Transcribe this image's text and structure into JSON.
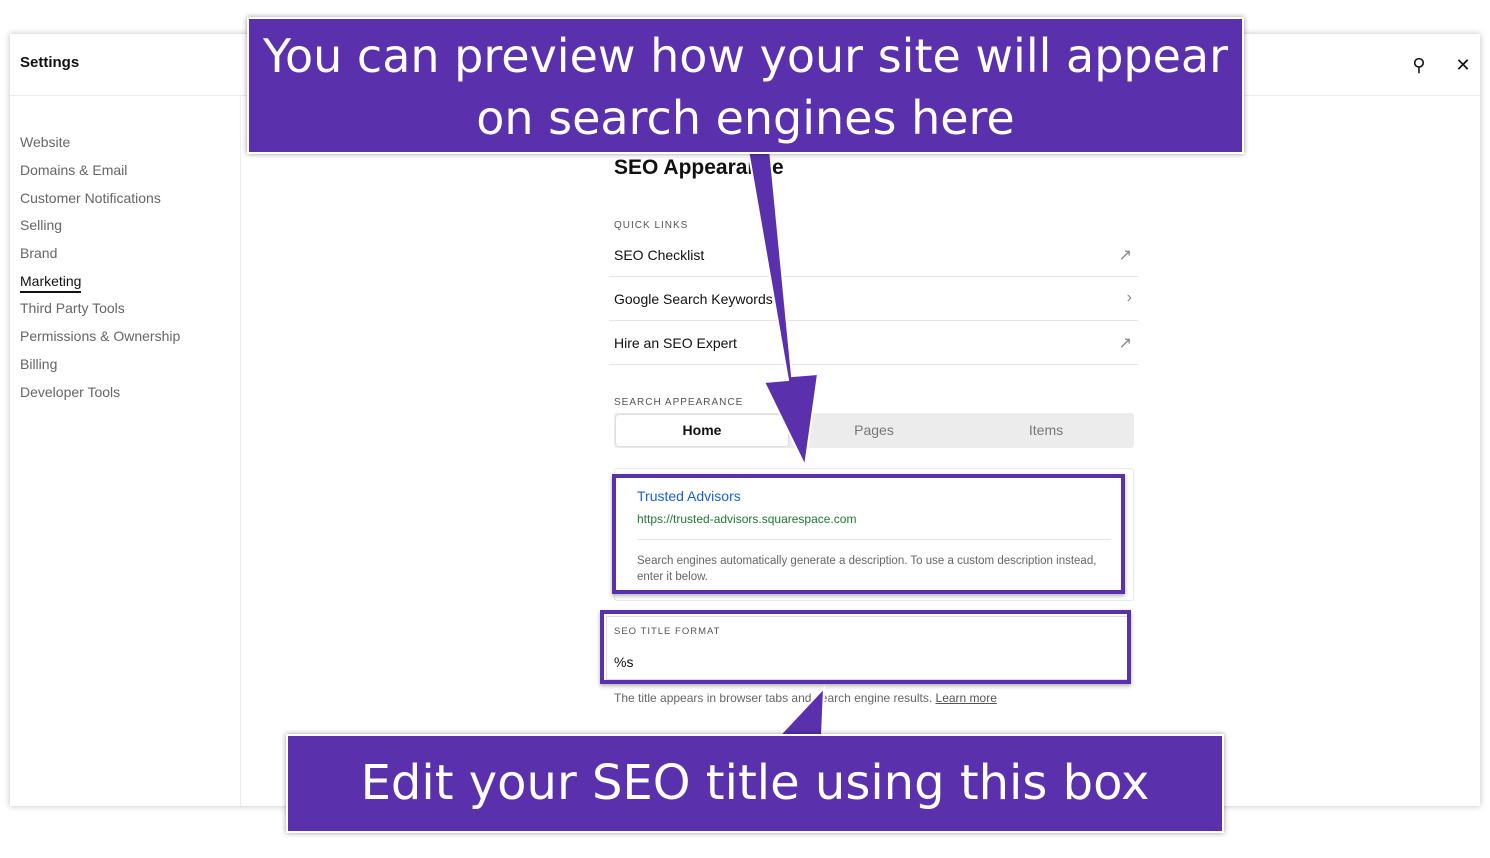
{
  "header": {
    "title": "Settings",
    "search_icon": "search-icon",
    "close_icon": "close-icon"
  },
  "sidebar": {
    "items": [
      {
        "label": "Website"
      },
      {
        "label": "Domains & Email"
      },
      {
        "label": "Customer Notifications"
      },
      {
        "label": "Selling"
      },
      {
        "label": "Brand"
      },
      {
        "label": "Marketing",
        "active": true
      },
      {
        "label": "Third Party Tools"
      },
      {
        "label": "Permissions & Ownership"
      },
      {
        "label": "Billing"
      },
      {
        "label": "Developer Tools"
      }
    ]
  },
  "main": {
    "title": "SEO Appearance",
    "quick_links_label": "QUICK LINKS",
    "quick_links": [
      {
        "label": "SEO Checklist",
        "icon": "external-link-icon"
      },
      {
        "label": "Google Search Keywords",
        "icon": "chevron-right-icon"
      },
      {
        "label": "Hire an SEO Expert",
        "icon": "external-link-icon"
      }
    ],
    "search_appearance_label": "SEARCH APPEARANCE",
    "tabs": [
      {
        "label": "Home",
        "active": true
      },
      {
        "label": "Pages"
      },
      {
        "label": "Items"
      }
    ],
    "preview": {
      "title": "Trusted Advisors",
      "url": "https://trusted-advisors.squarespace.com",
      "description": "Search engines automatically generate a description. To use a custom description instead, enter it below."
    },
    "seo_title": {
      "label": "SEO TITLE FORMAT",
      "value": "%s",
      "help": "The title appears in browser tabs and search engine results.",
      "learn_more": "Learn more"
    }
  },
  "callouts": {
    "top": "You can preview how your site will appear on search engines here",
    "bottom": "Edit your SEO title using this box",
    "color": "#5a30ad"
  }
}
